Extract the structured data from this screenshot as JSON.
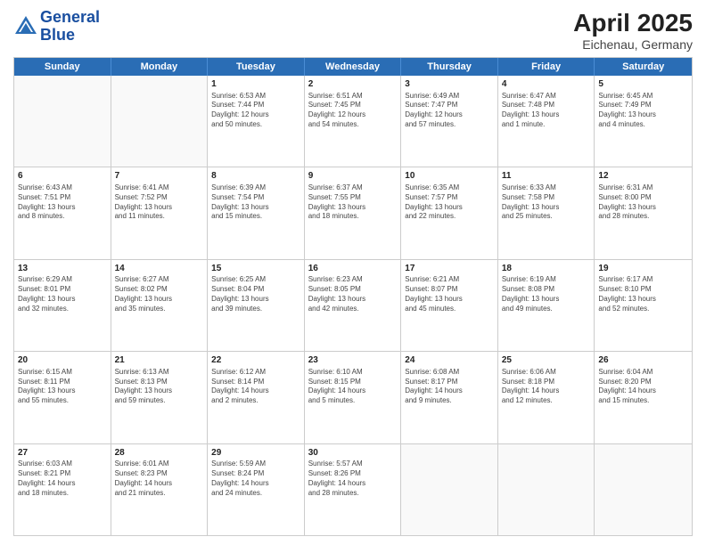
{
  "header": {
    "logo_line1": "General",
    "logo_line2": "Blue",
    "month": "April 2025",
    "location": "Eichenau, Germany"
  },
  "weekdays": [
    "Sunday",
    "Monday",
    "Tuesday",
    "Wednesday",
    "Thursday",
    "Friday",
    "Saturday"
  ],
  "rows": [
    [
      {
        "day": "",
        "info": ""
      },
      {
        "day": "",
        "info": ""
      },
      {
        "day": "1",
        "info": "Sunrise: 6:53 AM\nSunset: 7:44 PM\nDaylight: 12 hours\nand 50 minutes."
      },
      {
        "day": "2",
        "info": "Sunrise: 6:51 AM\nSunset: 7:45 PM\nDaylight: 12 hours\nand 54 minutes."
      },
      {
        "day": "3",
        "info": "Sunrise: 6:49 AM\nSunset: 7:47 PM\nDaylight: 12 hours\nand 57 minutes."
      },
      {
        "day": "4",
        "info": "Sunrise: 6:47 AM\nSunset: 7:48 PM\nDaylight: 13 hours\nand 1 minute."
      },
      {
        "day": "5",
        "info": "Sunrise: 6:45 AM\nSunset: 7:49 PM\nDaylight: 13 hours\nand 4 minutes."
      }
    ],
    [
      {
        "day": "6",
        "info": "Sunrise: 6:43 AM\nSunset: 7:51 PM\nDaylight: 13 hours\nand 8 minutes."
      },
      {
        "day": "7",
        "info": "Sunrise: 6:41 AM\nSunset: 7:52 PM\nDaylight: 13 hours\nand 11 minutes."
      },
      {
        "day": "8",
        "info": "Sunrise: 6:39 AM\nSunset: 7:54 PM\nDaylight: 13 hours\nand 15 minutes."
      },
      {
        "day": "9",
        "info": "Sunrise: 6:37 AM\nSunset: 7:55 PM\nDaylight: 13 hours\nand 18 minutes."
      },
      {
        "day": "10",
        "info": "Sunrise: 6:35 AM\nSunset: 7:57 PM\nDaylight: 13 hours\nand 22 minutes."
      },
      {
        "day": "11",
        "info": "Sunrise: 6:33 AM\nSunset: 7:58 PM\nDaylight: 13 hours\nand 25 minutes."
      },
      {
        "day": "12",
        "info": "Sunrise: 6:31 AM\nSunset: 8:00 PM\nDaylight: 13 hours\nand 28 minutes."
      }
    ],
    [
      {
        "day": "13",
        "info": "Sunrise: 6:29 AM\nSunset: 8:01 PM\nDaylight: 13 hours\nand 32 minutes."
      },
      {
        "day": "14",
        "info": "Sunrise: 6:27 AM\nSunset: 8:02 PM\nDaylight: 13 hours\nand 35 minutes."
      },
      {
        "day": "15",
        "info": "Sunrise: 6:25 AM\nSunset: 8:04 PM\nDaylight: 13 hours\nand 39 minutes."
      },
      {
        "day": "16",
        "info": "Sunrise: 6:23 AM\nSunset: 8:05 PM\nDaylight: 13 hours\nand 42 minutes."
      },
      {
        "day": "17",
        "info": "Sunrise: 6:21 AM\nSunset: 8:07 PM\nDaylight: 13 hours\nand 45 minutes."
      },
      {
        "day": "18",
        "info": "Sunrise: 6:19 AM\nSunset: 8:08 PM\nDaylight: 13 hours\nand 49 minutes."
      },
      {
        "day": "19",
        "info": "Sunrise: 6:17 AM\nSunset: 8:10 PM\nDaylight: 13 hours\nand 52 minutes."
      }
    ],
    [
      {
        "day": "20",
        "info": "Sunrise: 6:15 AM\nSunset: 8:11 PM\nDaylight: 13 hours\nand 55 minutes."
      },
      {
        "day": "21",
        "info": "Sunrise: 6:13 AM\nSunset: 8:13 PM\nDaylight: 13 hours\nand 59 minutes."
      },
      {
        "day": "22",
        "info": "Sunrise: 6:12 AM\nSunset: 8:14 PM\nDaylight: 14 hours\nand 2 minutes."
      },
      {
        "day": "23",
        "info": "Sunrise: 6:10 AM\nSunset: 8:15 PM\nDaylight: 14 hours\nand 5 minutes."
      },
      {
        "day": "24",
        "info": "Sunrise: 6:08 AM\nSunset: 8:17 PM\nDaylight: 14 hours\nand 9 minutes."
      },
      {
        "day": "25",
        "info": "Sunrise: 6:06 AM\nSunset: 8:18 PM\nDaylight: 14 hours\nand 12 minutes."
      },
      {
        "day": "26",
        "info": "Sunrise: 6:04 AM\nSunset: 8:20 PM\nDaylight: 14 hours\nand 15 minutes."
      }
    ],
    [
      {
        "day": "27",
        "info": "Sunrise: 6:03 AM\nSunset: 8:21 PM\nDaylight: 14 hours\nand 18 minutes."
      },
      {
        "day": "28",
        "info": "Sunrise: 6:01 AM\nSunset: 8:23 PM\nDaylight: 14 hours\nand 21 minutes."
      },
      {
        "day": "29",
        "info": "Sunrise: 5:59 AM\nSunset: 8:24 PM\nDaylight: 14 hours\nand 24 minutes."
      },
      {
        "day": "30",
        "info": "Sunrise: 5:57 AM\nSunset: 8:26 PM\nDaylight: 14 hours\nand 28 minutes."
      },
      {
        "day": "",
        "info": ""
      },
      {
        "day": "",
        "info": ""
      },
      {
        "day": "",
        "info": ""
      }
    ]
  ]
}
